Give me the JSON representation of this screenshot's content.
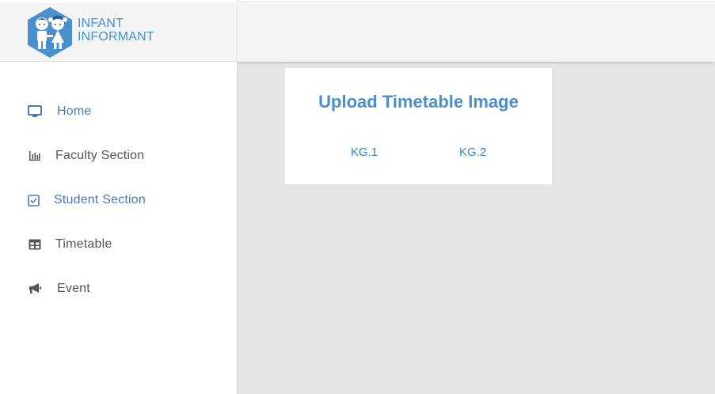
{
  "brand": {
    "line1": "INFANT",
    "line2": "INFORMANT",
    "color": "#4a90cf"
  },
  "sidebar": {
    "items": [
      {
        "label": "Home",
        "icon": "monitor-icon",
        "active": true
      },
      {
        "label": "Faculty Section",
        "icon": "bar-chart-icon",
        "active": false
      },
      {
        "label": "Student Section",
        "icon": "checkbox-icon",
        "active": true
      },
      {
        "label": "Timetable",
        "icon": "table-icon",
        "active": false
      },
      {
        "label": "Event",
        "icon": "megaphone-icon",
        "active": false
      }
    ]
  },
  "main": {
    "title": "Upload Timetable Image",
    "classes": [
      "KG.1",
      "KG.2"
    ]
  },
  "colors": {
    "accent": "#4a8ed0",
    "active_nav": "#4a78c0",
    "text": "#555555",
    "background": "#e5e5e5"
  }
}
